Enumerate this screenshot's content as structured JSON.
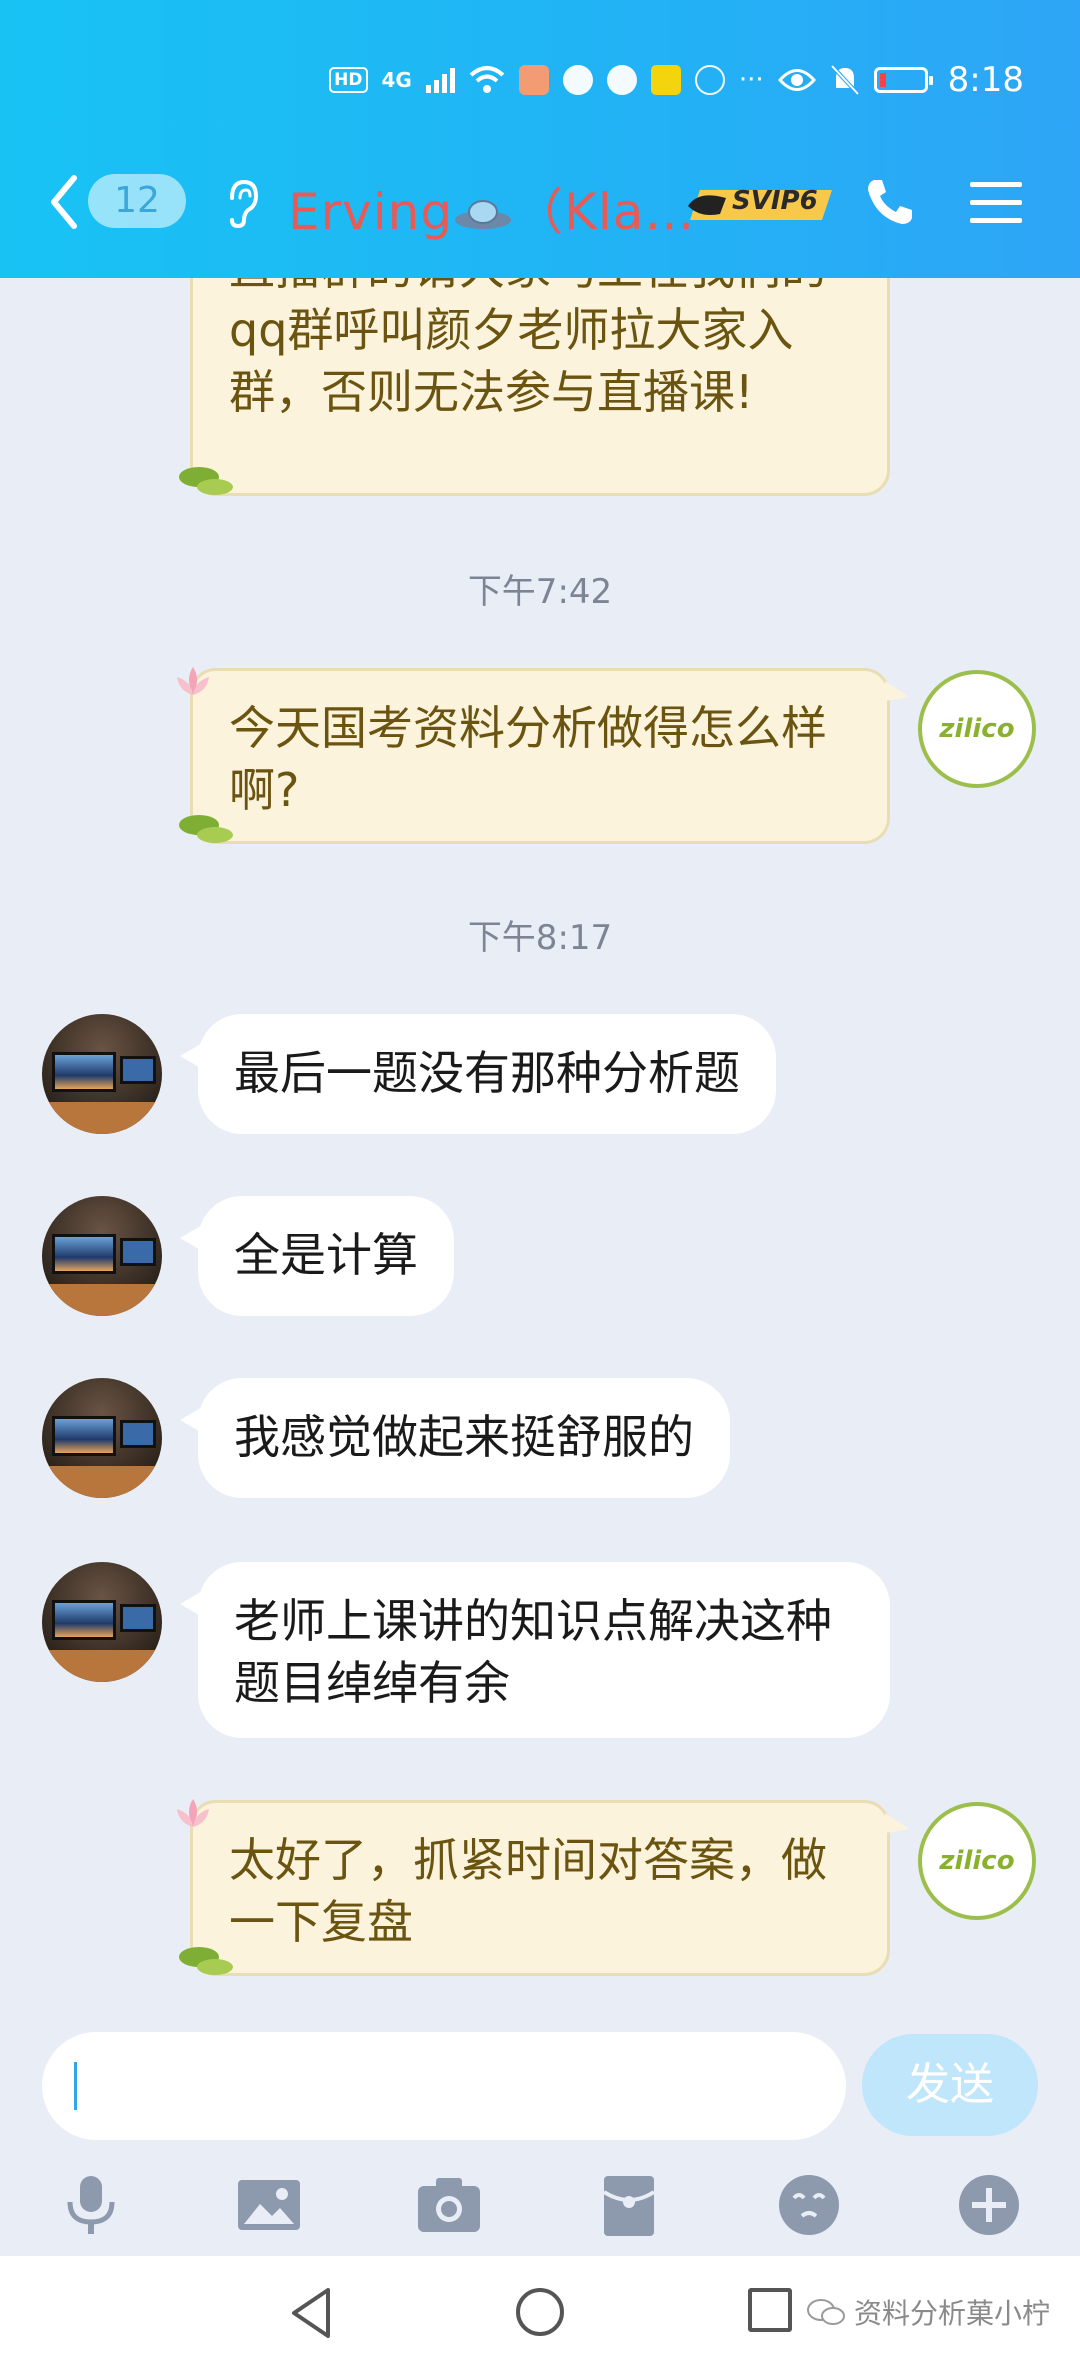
{
  "status_bar": {
    "hd": "HD",
    "network": "4G",
    "time": "8:18"
  },
  "nav": {
    "unread_count": "12",
    "title": "Erving",
    "title_suffix": "（Kla…",
    "badge": "SVIP6"
  },
  "messages": [
    {
      "type": "out",
      "text": "直播群的请大家马上在我们的qq群呼叫颜夕老师拉大家入群，否则无法参与直播课!"
    },
    {
      "type": "timestamp",
      "text": "下午7:42"
    },
    {
      "type": "out",
      "text": "今天国考资料分析做得怎么样啊?"
    },
    {
      "type": "timestamp",
      "text": "下午8:17"
    },
    {
      "type": "in",
      "text": "最后一题没有那种分析题"
    },
    {
      "type": "in",
      "text": "全是计算"
    },
    {
      "type": "in",
      "text": "我感觉做起来挺舒服的"
    },
    {
      "type": "in",
      "text": "老师上课讲的知识点解决这种题目绰绰有余"
    },
    {
      "type": "out",
      "text": "太好了，抓紧时间对答案，做一下复盘"
    }
  ],
  "avatar_out_text": "zilico",
  "input": {
    "value": "",
    "send_label": "发送"
  },
  "toolbar": [
    "microphone-icon",
    "image-icon",
    "camera-icon",
    "red-packet-icon",
    "emoji-icon",
    "plus-icon"
  ],
  "watermark": "资料分析菓小柠",
  "colors": {
    "header_gradient_start": "#18c3f4",
    "header_gradient_end": "#2ea5f6",
    "title_color": "#e85a55",
    "out_bubble": "#fbf3dc",
    "in_bubble": "#ffffff",
    "chat_background": "#e9edf5",
    "send_button": "#bfe6fa"
  }
}
